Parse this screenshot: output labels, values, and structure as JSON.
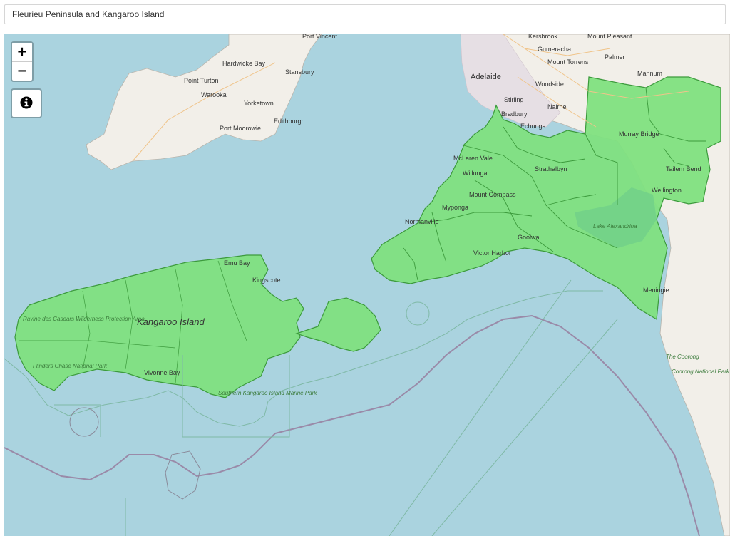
{
  "header": {
    "title": "Fleurieu Peninsula and Kangaroo Island"
  },
  "controls": {
    "zoom_in": "+",
    "zoom_out": "−"
  },
  "icons": {
    "info": "info-circle-icon"
  },
  "colors": {
    "water": "#aad3df",
    "land": "#f2efe9",
    "region_fill": "#7fe07f",
    "region_stroke": "#3c9a3c",
    "boundary": "#9a8aa8"
  },
  "labels": {
    "port_vincent": "Port Vincent",
    "hardwicke_bay": "Hardwicke Bay",
    "point_turton": "Point Turton",
    "warooka": "Warooka",
    "stansbury": "Stansbury",
    "yorketown": "Yorketown",
    "port_moorowie": "Port Moorowie",
    "edithburgh": "Edithburgh",
    "kersbrook": "Kersbrook",
    "mount_pleasant": "Mount Pleasant",
    "gumeracha": "Gumeracha",
    "palmer": "Palmer",
    "adelaide": "Adelaide",
    "mount_torrens": "Mount Torrens",
    "mannum": "Mannum",
    "woodside": "Woodside",
    "stirling": "Stirling",
    "nairne": "Nairne",
    "bradbury": "Bradbury",
    "echunga": "Echunga",
    "murray_bridge": "Murray Bridge",
    "mclaren_vale": "McLaren Vale",
    "willunga": "Willunga",
    "strathalbyn": "Strathalbyn",
    "tailem_bend": "Tailem Bend",
    "wellington": "Wellington",
    "mount_compass": "Mount Compass",
    "myponga": "Myponga",
    "normanville": "Normanville",
    "goolwa": "Goolwa",
    "lake_alexandrina": "Lake Alexandrina",
    "victor_harbor": "Victor Harbor",
    "emu_bay": "Emu Bay",
    "kingscote": "Kingscote",
    "meningie": "Meningie",
    "kangaroo_island": "Kangaroo Island",
    "ravine_park": "Ravine des Casoars Wilderness Protection Area",
    "flinders_chase": "Flinders Chase National Park",
    "vivonne_bay": "Vivonne Bay",
    "southern_ki_marine_park": "Southern Kangaroo Island Marine Park",
    "the_coorong": "The Coorong",
    "coorong_np": "Coorong National Park"
  }
}
